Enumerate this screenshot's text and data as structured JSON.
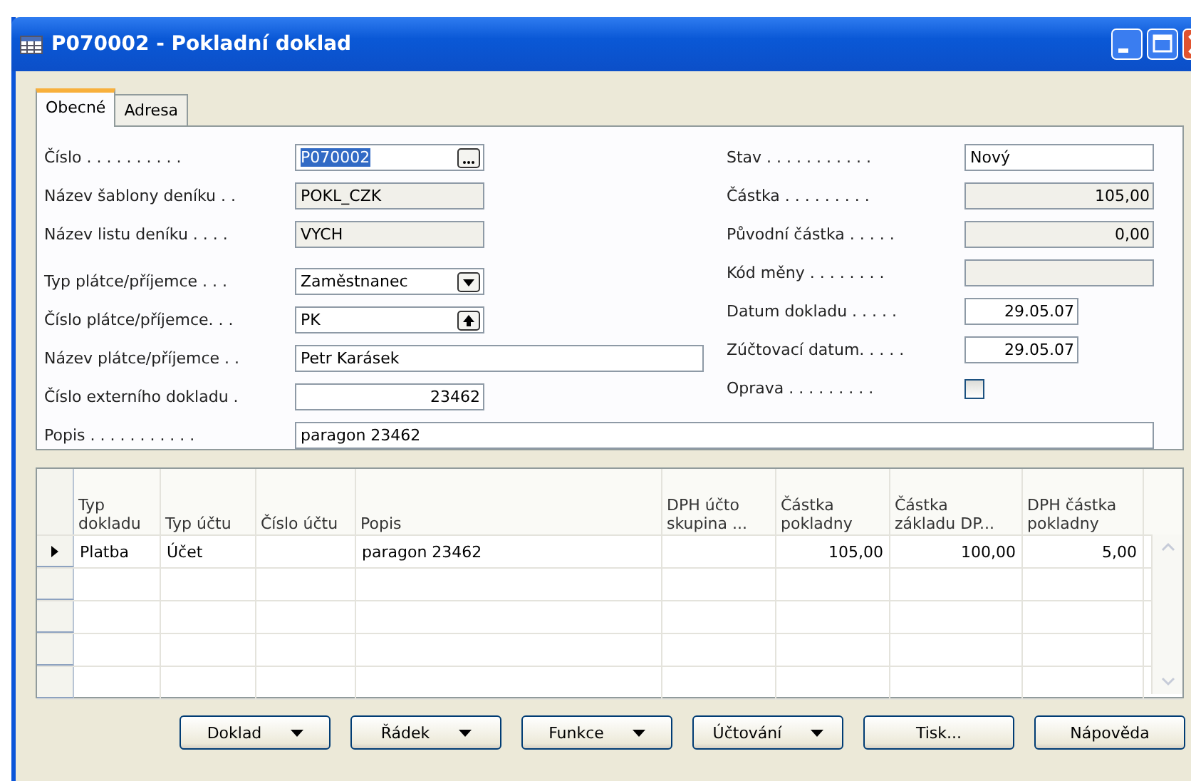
{
  "window": {
    "title": "P070002 - Pokladní doklad"
  },
  "tabs": [
    {
      "label": "Obecné",
      "selected": true
    },
    {
      "label": "Adresa",
      "selected": false
    }
  ],
  "left_fields": [
    {
      "label": "Číslo . . . . . . . . . .",
      "value": "P070002",
      "kind": "ellipsis",
      "readonly": false,
      "highlighted": true
    },
    {
      "label": "Název šablony deníku . .",
      "value": "POKL_CZK",
      "kind": "text",
      "readonly": true,
      "highlighted": false
    },
    {
      "label": "Název listu deníku . . . .",
      "value": "VYCH",
      "kind": "text",
      "readonly": true,
      "highlighted": false
    },
    {
      "label": "Typ plátce/příjemce . . .",
      "value": "Zaměstnanec",
      "kind": "dropdown",
      "readonly": false,
      "highlighted": false
    },
    {
      "label": "Číslo plátce/příjemce. . .",
      "value": "PK",
      "kind": "lookup",
      "readonly": false,
      "highlighted": false
    },
    {
      "label": "Název plátce/příjemce . .",
      "value": "Petr Karásek",
      "kind": "wide",
      "readonly": false,
      "highlighted": false
    },
    {
      "label": "Číslo externího dokladu .",
      "value": "23462",
      "kind": "number",
      "readonly": false,
      "highlighted": false
    }
  ],
  "right_fields": [
    {
      "label": "Stav . . . . . . . . . . .",
      "value": "Nový",
      "kind": "text",
      "readonly": false
    },
    {
      "label": "Částka . . . . . . . . .",
      "value": "105,00",
      "kind": "number",
      "readonly": true
    },
    {
      "label": "Původní částka . . . . .",
      "value": "0,00",
      "kind": "number",
      "readonly": true
    },
    {
      "label": "Kód měny . . . . . . . .",
      "kind": "text",
      "readonly": true
    },
    {
      "label": "Datum dokladu . . . . .",
      "value": "29.05.07",
      "kind": "date",
      "readonly": false
    },
    {
      "label": "Zúčtovací datum. . . . .",
      "value": "29.05.07",
      "kind": "date",
      "readonly": false
    },
    {
      "label": "Oprava . . . . . . . . .",
      "kind": "checkbox",
      "checked": false
    }
  ],
  "description_field": {
    "label": "Popis . . . . . . . . . . .",
    "value": "paragon 23462"
  },
  "table": {
    "columns": [
      {
        "label": "Typ\ndokladu",
        "kind": "text"
      },
      {
        "label": "Typ účtu",
        "kind": "text"
      },
      {
        "label": "Číslo účtu",
        "kind": "text"
      },
      {
        "label": "Popis",
        "kind": "text"
      },
      {
        "label": "DPH účto\nskupina ...",
        "kind": "text"
      },
      {
        "label": "Částka\npokladny",
        "kind": "amount"
      },
      {
        "label": "Částka\nzákladu DP...",
        "kind": "amount"
      },
      {
        "label": "DPH částka\npokladny",
        "kind": "amount"
      }
    ],
    "rows": [
      {
        "current": true,
        "cells": [
          "Platba",
          "Účet",
          null,
          "paragon 23462",
          null,
          "105,00",
          "100,00",
          "5,00"
        ]
      }
    ]
  },
  "buttons": [
    {
      "label": "Doklad",
      "menu": true
    },
    {
      "label": "Řádek",
      "menu": true
    },
    {
      "label": "Funkce",
      "menu": true
    },
    {
      "label": "Účtování",
      "menu": true
    },
    {
      "label": "Tisk...",
      "menu": false
    },
    {
      "label": "Nápověda",
      "menu": false
    }
  ]
}
